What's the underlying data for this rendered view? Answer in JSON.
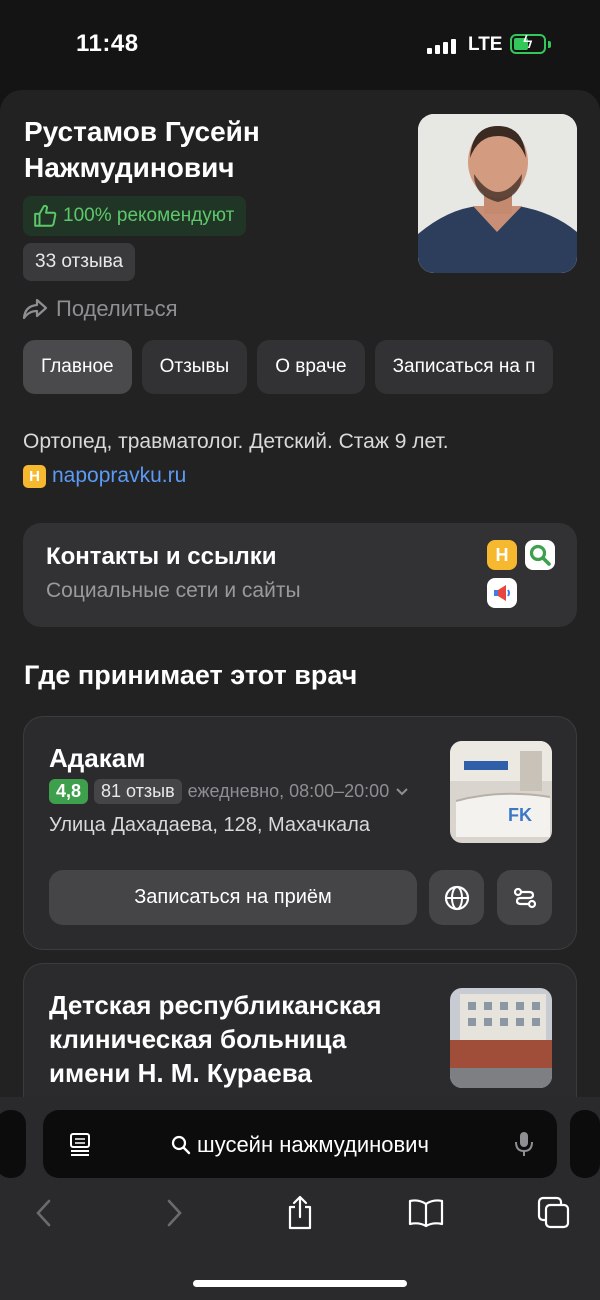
{
  "status": {
    "time": "11:48",
    "network": "LTE"
  },
  "doctor": {
    "name": "Рустамов Гусейн Нажмудинович",
    "recommend": "100% рекомендуют",
    "reviews": "33 отзыва",
    "share": "Поделиться",
    "specialty": "Ортопед, травматолог. Детский. Стаж 9 лет.",
    "source_badge": "Н",
    "source": "napopravku.ru"
  },
  "tabs": [
    {
      "label": "Главное",
      "active": true
    },
    {
      "label": "Отзывы"
    },
    {
      "label": "О враче"
    },
    {
      "label": "Записаться на п"
    }
  ],
  "contacts": {
    "title": "Контакты и ссылки",
    "subtitle": "Социальные сети и сайты",
    "icons": [
      "napopravku-icon",
      "prodoctorov-search-icon",
      "megaphone-icon"
    ]
  },
  "where": {
    "title": "Где принимает этот врач",
    "clinics": [
      {
        "name": "Адакам",
        "rating": "4,8",
        "reviews": "81 отзыв",
        "hours": "ежедневно, 08:00–20:00",
        "address": "Улица Дахадаева, 128, Махачкала",
        "book_label": "Записаться на приём"
      },
      {
        "name": "Детская республиканская клиническая больница имени Н. М. Кураева"
      }
    ]
  },
  "browser": {
    "query": "шусейн нажмудинович"
  },
  "colors": {
    "accent_green": "#5cc86a",
    "link_blue": "#5b9af5",
    "badge_yellow": "#f5b82e"
  }
}
